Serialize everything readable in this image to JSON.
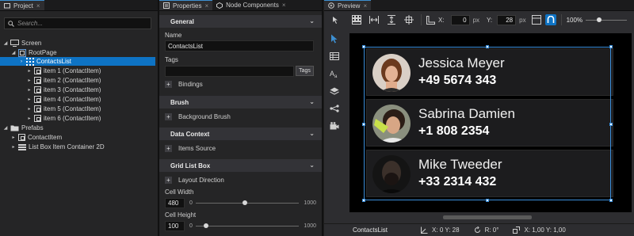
{
  "project": {
    "tab_label": "Project",
    "search_placeholder": "Search...",
    "tree": [
      {
        "label": "Screen",
        "icon": "screen-icon"
      },
      {
        "label": "RootPage",
        "icon": "page-icon"
      },
      {
        "label": "ContactsList",
        "icon": "grid-list-icon",
        "selected": true
      },
      {
        "label": "item 1 (ContactItem)",
        "icon": "node-icon"
      },
      {
        "label": "item 2 (ContactItem)",
        "icon": "node-icon"
      },
      {
        "label": "item 3 (ContactItem)",
        "icon": "node-icon"
      },
      {
        "label": "item 4 (ContactItem)",
        "icon": "node-icon"
      },
      {
        "label": "item 5 (ContactItem)",
        "icon": "node-icon"
      },
      {
        "label": "item 6 (ContactItem)",
        "icon": "node-icon"
      },
      {
        "label": "Prefabs",
        "icon": "folder-icon"
      },
      {
        "label": "ContactItem",
        "icon": "node-icon"
      },
      {
        "label": "List Box Item Container 2D",
        "icon": "list-icon"
      }
    ]
  },
  "properties": {
    "tab_label": "Properties",
    "tab2_label": "Node Components",
    "sections": {
      "general": "General",
      "brush": "Brush",
      "data_context": "Data Context",
      "grid_list_box": "Grid List Box"
    },
    "name_label": "Name",
    "name_value": "ContactsList",
    "tags_label": "Tags",
    "tags_button": "Tags",
    "bindings": "Bindings",
    "background_brush": "Background Brush",
    "items_source": "Items Source",
    "layout_direction": "Layout Direction",
    "cell_width": {
      "label": "Cell Width",
      "value": "480",
      "min": "0",
      "max": "1000",
      "fraction": 0.48
    },
    "cell_height": {
      "label": "Cell Height",
      "value": "100",
      "min": "0",
      "max": "1000",
      "fraction": 0.1
    }
  },
  "preview": {
    "tab_label": "Preview",
    "x_label": "X:",
    "x_value": "0",
    "x_unit": "px",
    "y_label": "Y:",
    "y_value": "28",
    "y_unit": "px",
    "zoom": "100%",
    "contacts": [
      {
        "name": "Jessica Meyer",
        "phone": "+49 5674 343"
      },
      {
        "name": "Sabrina Damien",
        "phone": "+1 808 2354"
      },
      {
        "name": "Mike Tweeder",
        "phone": "+33 2314 432"
      }
    ],
    "status": {
      "node": "ContactsList",
      "position": "X: 0  Y: 28",
      "rotation": "R: 0°",
      "scale": "X: 1,00  Y: 1,00"
    }
  },
  "colors": {
    "accent": "#0e73c4",
    "selection_border": "#3a8edb",
    "panel_bg": "#252526",
    "canvas_bg": "#000000"
  }
}
